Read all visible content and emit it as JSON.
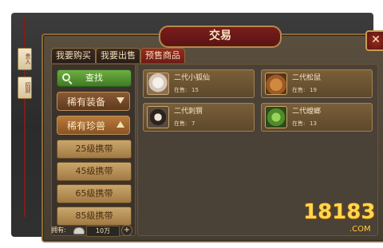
{
  "window": {
    "title": "交易",
    "close_symbol": "✕"
  },
  "tabs": [
    {
      "label": "我要购买",
      "active": false
    },
    {
      "label": "我要出售",
      "active": false
    },
    {
      "label": "预售商品",
      "active": true
    }
  ],
  "left_ornaments": [
    {
      "label": "贵人"
    },
    {
      "label": "招财"
    }
  ],
  "sidebar": {
    "search_label": "查找",
    "categories": [
      {
        "label": "稀有装备",
        "state": "collapsed",
        "icon": "arrow-down-icon"
      },
      {
        "label": "稀有珍兽",
        "state": "expanded",
        "icon": "arrow-up-icon"
      }
    ],
    "subitems": [
      {
        "label": "25级携带"
      },
      {
        "label": "45级携带"
      },
      {
        "label": "65级携带"
      },
      {
        "label": "85级携带"
      }
    ]
  },
  "items": [
    {
      "name": "二代小狐仙",
      "stock_label": "在售:",
      "stock": "15",
      "icon": "fox-icon"
    },
    {
      "name": "二代松鼠",
      "stock_label": "在售:",
      "stock": "19",
      "icon": "squirrel-icon"
    },
    {
      "name": "二代刺猬",
      "stock_label": "在售:",
      "stock": "7",
      "icon": "hedgehog-icon"
    },
    {
      "name": "二代螳螂",
      "stock_label": "在售:",
      "stock": "13",
      "icon": "mantis-icon"
    }
  ],
  "footer": {
    "owned_label": "拥有:",
    "currency_icon": "silver-ingot-icon",
    "value": "10万",
    "add_symbol": "+"
  },
  "watermark": {
    "main": "18183",
    "sub": ".COM"
  }
}
